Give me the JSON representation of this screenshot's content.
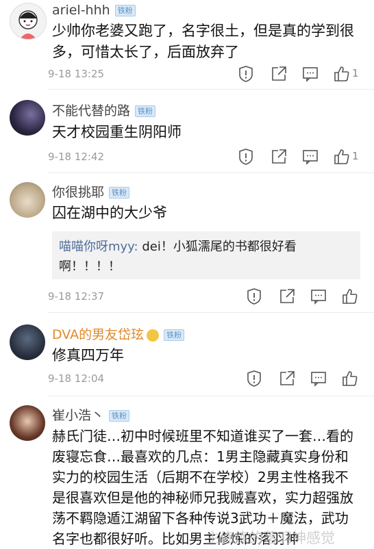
{
  "badge_text": "铁粉",
  "comments": [
    {
      "user": "ariel-hhh",
      "text": "少帅你老婆又跑了，名字很土，但是真的学到很多，可惜太长了，后面放弃了",
      "time": "9-18 13:25",
      "likes": "1"
    },
    {
      "user": "不能代替的路",
      "text": "天才校园重生阴阳师",
      "time": "9-18 12:42",
      "likes": "1"
    },
    {
      "user": "你很挑耶",
      "text": "囚在湖中的大少爷",
      "reply_user": "喵喵你呀myy:",
      "reply_text": " dei！小狐濡尾的书都很好看啊！！！！",
      "time": "9-18 12:37",
      "likes": ""
    },
    {
      "user": "DVA的男友岱玹",
      "text": "修真四万年",
      "time": "9-18 12:04",
      "likes": ""
    },
    {
      "user": "崔小浩丶",
      "text": "赫氏门徒…初中时候班里不知道谁买了一套…看的废寝忘食…最喜欢的几点：1男主隐藏真实身份和实力的校园生活（后期不在学校）2男主性格我不是很喜欢但是他的神秘师兄我贼喜欢，实力超强放荡不羁隐遁江湖留下各种传说3武功＋魔法，武功名字也都很好听。比如男主修炼的落羽神",
      "time": "",
      "likes": ""
    }
  ],
  "watermark": "主修炼的落羽神感觉"
}
